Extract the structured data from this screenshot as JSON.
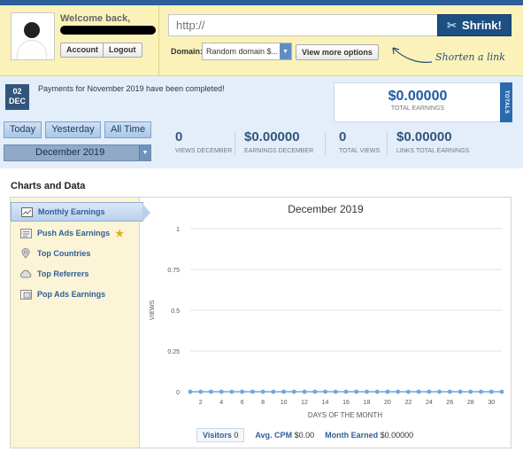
{
  "header": {
    "welcome": "Welcome back,",
    "account_label": "Account",
    "logout_label": "Logout",
    "url_placeholder": "http://",
    "shrink_label": "Shrink!",
    "domain_label": "Domain:",
    "domain_value": "Random domain $...",
    "more_options_label": "View more options",
    "shorten_hint": "Shorten a link"
  },
  "stats": {
    "date_day": "02",
    "date_month": "DEC",
    "notice": "Payments for November 2019 have been completed!",
    "total_earnings_value": "$0.00000",
    "total_earnings_label": "TOTAL EARNINGS",
    "totals_tab": "TOTALS",
    "range_buttons": [
      "Today",
      "Yesterday",
      "All Time"
    ],
    "month_select": "December 2019",
    "items": [
      {
        "value": "0",
        "label": "VIEWS DECEMBER"
      },
      {
        "value": "$0.00000",
        "label": "EARNINGS DECEMBER"
      },
      {
        "value": "0",
        "label": "TOTAL VIEWS"
      },
      {
        "value": "$0.00000",
        "label": "LINKS TOTAL EARNINGS"
      }
    ]
  },
  "charts": {
    "section_title": "Charts and Data",
    "sidebar": [
      {
        "label": "Monthly Earnings",
        "icon": "chart-icon"
      },
      {
        "label": "Push Ads Earnings",
        "icon": "newspaper-icon"
      },
      {
        "label": "Top Countries",
        "icon": "map-pin-icon"
      },
      {
        "label": "Top Referrers",
        "icon": "cloud-icon"
      },
      {
        "label": "Pop Ads Earnings",
        "icon": "popup-icon"
      }
    ],
    "legend": {
      "visitors_label": "Visitors",
      "visitors_value": "0",
      "cpm_label": "Avg. CPM",
      "cpm_value": "$0.00",
      "month_label": "Month Earned",
      "month_value": "$0.00000"
    }
  },
  "chart_data": {
    "type": "line",
    "title": "December 2019",
    "xlabel": "DAYS OF THE MONTH",
    "ylabel": "VIEWS",
    "x": [
      1,
      2,
      3,
      4,
      5,
      6,
      7,
      8,
      9,
      10,
      11,
      12,
      13,
      14,
      15,
      16,
      17,
      18,
      19,
      20,
      21,
      22,
      23,
      24,
      25,
      26,
      27,
      28,
      29,
      30,
      31
    ],
    "x_tick_labels": [
      "2",
      "4",
      "6",
      "8",
      "10",
      "12",
      "14",
      "16",
      "18",
      "20",
      "22",
      "24",
      "26",
      "28",
      "30"
    ],
    "y_tick_labels": [
      "0",
      "0.25",
      "0.5",
      "0.75",
      "1"
    ],
    "series": [
      {
        "values": [
          0,
          0,
          0,
          0,
          0,
          0,
          0,
          0,
          0,
          0,
          0,
          0,
          0,
          0,
          0,
          0,
          0,
          0,
          0,
          0,
          0,
          0,
          0,
          0,
          0,
          0,
          0,
          0,
          0,
          0,
          0
        ],
        "color": "#6fa8dc"
      }
    ],
    "ylim": [
      0,
      1
    ],
    "xlim": [
      1,
      31
    ],
    "grid": true
  }
}
